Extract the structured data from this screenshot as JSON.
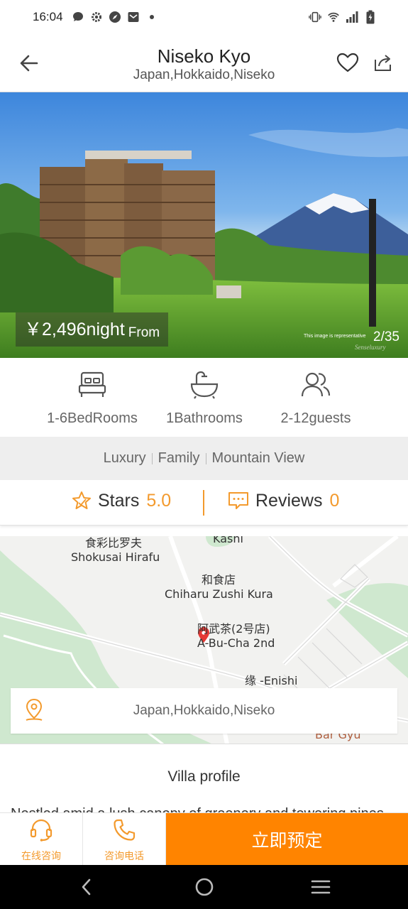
{
  "status_bar": {
    "time": "16:04",
    "left_icons": [
      "chat-bubble-icon",
      "settings-icon",
      "compass-icon",
      "mail-icon",
      "dot-icon"
    ],
    "right_icons": [
      "vibrate-icon",
      "wifi-icon",
      "signal-icon",
      "battery-charging-icon"
    ]
  },
  "header": {
    "title": "Niseko Kyo",
    "subtitle": "Japan,Hokkaido,Niseko"
  },
  "hero": {
    "price": "￥2,496night",
    "price_suffix": "From",
    "counter": "2/35",
    "note": "This image is representative",
    "watermark": "Senseluxury"
  },
  "facilities": [
    {
      "icon": "bed-icon",
      "label": "1-6BedRooms"
    },
    {
      "icon": "bathtub-icon",
      "label": "1Bathrooms"
    },
    {
      "icon": "guests-icon",
      "label": "2-12guests"
    }
  ],
  "tags": [
    "Luxury",
    "Family",
    "Mountain View"
  ],
  "rating": {
    "stars_label": "Stars",
    "stars_value": "5.0",
    "reviews_label": "Reviews",
    "reviews_value": "0"
  },
  "map": {
    "labels": {
      "top_partial": "Kashi",
      "shokusai_cn": "食彩比罗夫",
      "shokusai_en": "Shokusai Hirafu",
      "chiharu_cn": "和食店",
      "chiharu_en": "Chiharu Zushi Kura",
      "abucha_cn": "阿武茶(2号店)",
      "abucha_en": "A-Bu-Cha 2nd",
      "enishi": "缘 -Enishi",
      "bar_gyu": "Bar Gyu"
    },
    "address": "Japan,Hokkaido,Niseko"
  },
  "profile": {
    "title": "Villa profile",
    "text": "Nestled amid a lush canopy of greenery and towering pines"
  },
  "actions": {
    "consult_online": "在线咨询",
    "consult_phone": "咨询电话",
    "book_now": "立即预定"
  },
  "colors": {
    "accent_orange": "#ff8400",
    "text_orange": "#f39a2d"
  }
}
